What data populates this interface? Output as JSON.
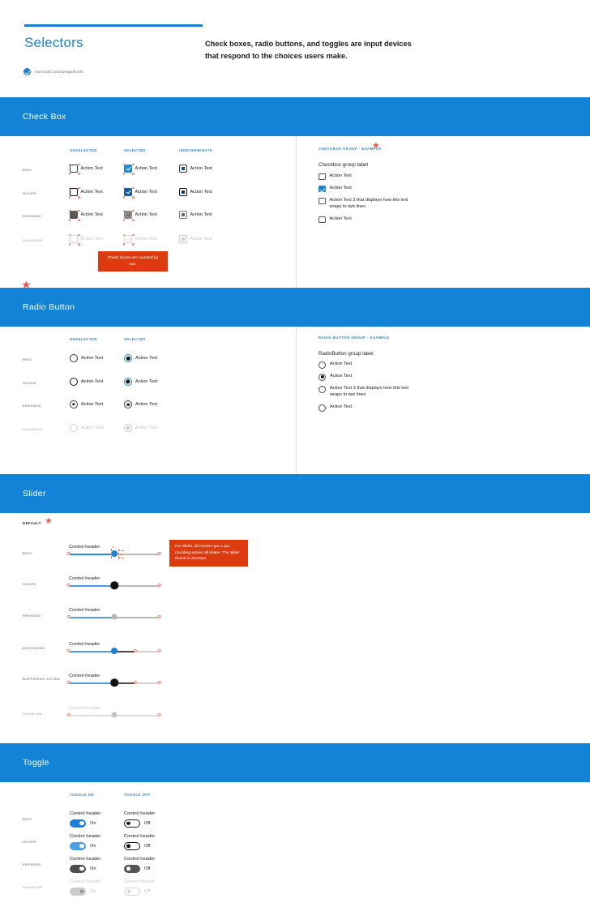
{
  "hero": {
    "title": "Selectors",
    "description": "Check boxes, radio buttons, and toggles are input devices that respond to the choices users make.",
    "link": "microsoft.com/design/fluent"
  },
  "colors": {
    "brand_blue": "#1283d6",
    "accent_blue": "#1d7fd4",
    "callout_orange": "#dd3a10",
    "redline": "#f08a72",
    "star_red": "#f4564a"
  },
  "checkbox_section": {
    "title": "Check Box",
    "column_headers": [
      "UNSELECTED",
      "SELECTED",
      "INDETERMINATE"
    ],
    "row_labels": [
      "REST",
      "HOVER",
      "PRESSED",
      "DISABLED"
    ],
    "action_text": "Action Text",
    "callout": "Check boxes are rounded by 2px.",
    "group": {
      "header": "CHECKBOX GROUP - EXAMPLE",
      "label": "Checkbox group label",
      "items": [
        {
          "text": "Action Text",
          "checked": false
        },
        {
          "text": "Action Text",
          "checked": true
        },
        {
          "text": "Action Text 3 that displays how this text wraps to two lines",
          "checked": false
        },
        {
          "text": "Action Text",
          "checked": false
        }
      ]
    }
  },
  "radio_section": {
    "title": "Radio Button",
    "column_headers": [
      "UNSELECTED",
      "SELECTED"
    ],
    "row_labels": [
      "REST",
      "HOVER",
      "PRESSED",
      "DISABLED"
    ],
    "action_text": "Action Text",
    "group": {
      "header": "RADIO BUTTON GROUP - EXAMPLE",
      "label": "RadioButton group label",
      "items": [
        {
          "text": "Action Text",
          "selected": false
        },
        {
          "text": "Action Text",
          "selected": true
        },
        {
          "text": "Action Text 3 that displays how this text wraps to two lines",
          "selected": false
        },
        {
          "text": "Action Text",
          "selected": false
        }
      ]
    }
  },
  "slider_section": {
    "title": "Slider",
    "group_header": "DEFAULT",
    "row_labels": [
      "REST",
      "HOVER",
      "PRESSED",
      "BUFFERING",
      "BUFFERING HOVER",
      "DISABLED"
    ],
    "control_header": "Control header",
    "callout": "For Slider, all corners get a 2px rounding across all states. The slider thumb is 20x20px",
    "redline_measure": "20"
  },
  "toggle_section": {
    "title": "Toggle",
    "column_headers": [
      "TOGGLE ON",
      "TOGGLE OFF"
    ],
    "row_labels": [
      "REST",
      "HOVER",
      "PRESSED",
      "DISABLED"
    ],
    "control_header": "Control header",
    "on_label": "On",
    "off_label": "Off"
  }
}
